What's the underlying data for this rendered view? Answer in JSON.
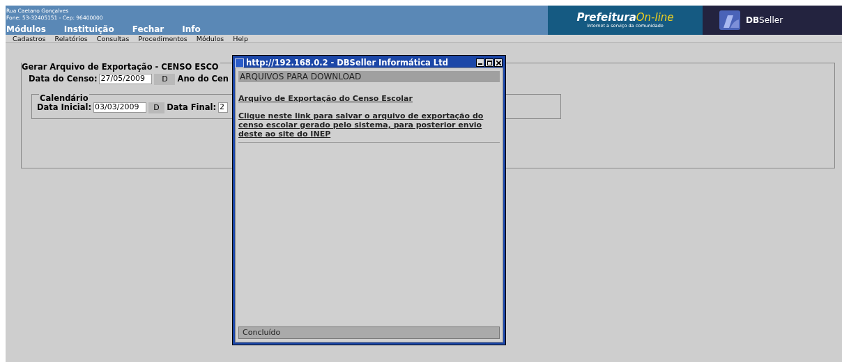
{
  "header": {
    "address": "Rua Caetano Gonçalves",
    "contact": "Fone: 53-32405151  -  Cep: 96400000",
    "brand": {
      "name_bold": "Prefeitura",
      "name_light": "On-line",
      "tagline": "Internet a serviço da comunidade"
    },
    "vendor": {
      "bold": "DB",
      "light": "Seller"
    }
  },
  "main_menu": [
    "Módulos",
    "Instituição",
    "Fechar",
    "Info"
  ],
  "sub_menu": [
    "Cadastros",
    "Relatórios",
    "Consultas",
    "Procedimentos",
    "Módulos",
    "Help"
  ],
  "form": {
    "legend": "Gerar Arquivo de Exportação - CENSO ESCO",
    "census_date": {
      "label": "Data do Censo:",
      "value": "27/05/2009",
      "button": "D"
    },
    "census_year_label": "Ano do Cen",
    "calendar": {
      "legend": "Calendário",
      "start": {
        "label": "Data Inicial:",
        "value": "03/03/2009",
        "button": "D"
      },
      "end": {
        "label": "Data Final:",
        "value": "2"
      }
    }
  },
  "dialog": {
    "title": "http://192.168.0.2 - DBSeller Informática Ltd",
    "heading": "ARQUIVOS PARA DOWNLOAD",
    "link": "Arquivo de Exportação do Censo Escolar",
    "description": "Clique neste link para salvar o arquivo de exportação do censo escolar gerado pelo sistema, para posterior envio deste ao site do INEP",
    "status": "Concluído"
  }
}
